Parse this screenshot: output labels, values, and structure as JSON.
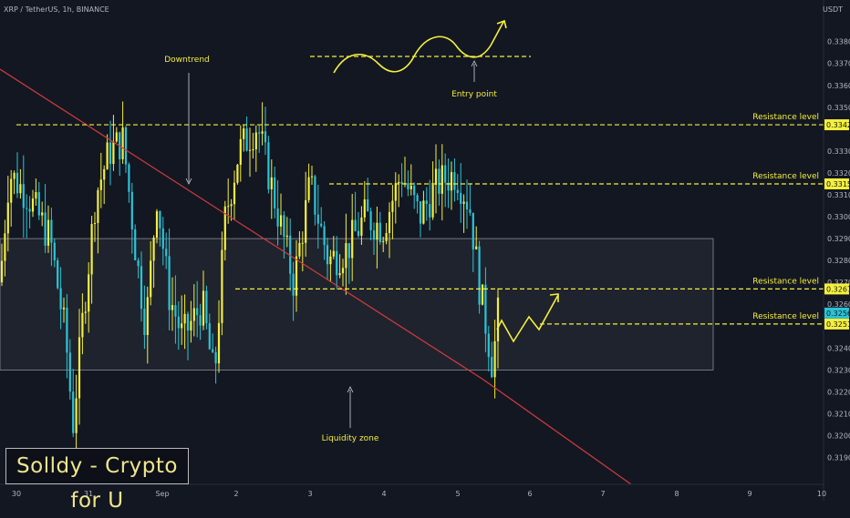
{
  "symbol_label": "XRP / TetherUS, 1h, BINANCE",
  "currency": "USDT",
  "watermark": "Solldy - Crypto for U",
  "colors": {
    "background": "#131722",
    "bull": "#f5ef3d",
    "bear": "#2bc4d6",
    "trendline": "#d23c3c",
    "annotation": "#f5ef3d",
    "axis_text": "#b2b5be"
  },
  "chart_data": {
    "type": "candlestick",
    "title": "XRP / TetherUS, 1h, BINANCE",
    "y_axis": {
      "ticks": [
        "0.3380",
        "0.3370",
        "0.3360",
        "0.3350",
        "0.3330",
        "0.3320",
        "0.3310",
        "0.3300",
        "0.3290",
        "0.3280",
        "0.3270",
        "0.3260",
        "0.3240",
        "0.3230",
        "0.3220",
        "0.3210",
        "0.3200",
        "0.3190"
      ],
      "ylim": [
        0.3184,
        0.3394
      ]
    },
    "x_axis": {
      "ticks": [
        "30",
        "31",
        "Sep",
        "2",
        "3",
        "4",
        "5",
        "6",
        "7",
        "8",
        "9",
        "10",
        "1"
      ]
    },
    "price_labels": [
      {
        "value": 0.3342,
        "text": "0.3342"
      },
      {
        "value": 0.3315,
        "text": "0.3315"
      },
      {
        "value": 0.3267,
        "text": "0.3267"
      },
      {
        "value": 0.3251,
        "text": "0.3251"
      }
    ],
    "current_price": {
      "value": 0.3256,
      "text": "0.3256"
    },
    "annotations": [
      {
        "text": "Downtrend"
      },
      {
        "text": "Entry point"
      },
      {
        "text": "Liquidity zone"
      },
      {
        "text": "Resistance level",
        "level": 0.3342
      },
      {
        "text": "Resistance level",
        "level": 0.3315
      },
      {
        "text": "Resistance level",
        "level": 0.3267
      },
      {
        "text": "Resistance level",
        "level": 0.3251
      }
    ],
    "liquidity_zone": {
      "low": 0.323,
      "high": 0.329
    },
    "grid": false
  }
}
